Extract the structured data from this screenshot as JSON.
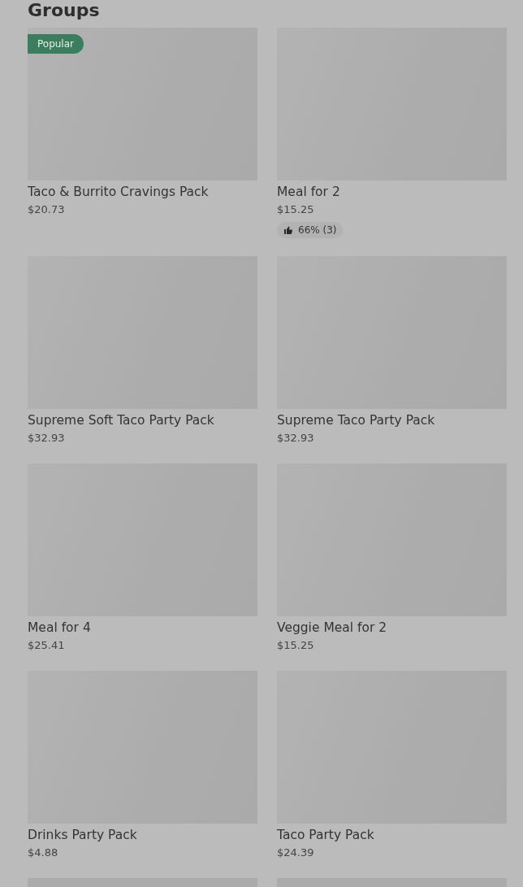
{
  "section": {
    "title": "Groups"
  },
  "items": [
    {
      "name": "Taco & Burrito Cravings Pack",
      "price": "$20.73",
      "badge": "Popular"
    },
    {
      "name": "Meal for 2",
      "price": "$15.25",
      "rating": "66% (3)"
    },
    {
      "name": "Supreme Soft Taco Party Pack",
      "price": "$32.93"
    },
    {
      "name": "Supreme Taco Party Pack",
      "price": "$32.93"
    },
    {
      "name": "Meal for 4",
      "price": "$25.41"
    },
    {
      "name": "Veggie Meal for 2",
      "price": "$15.25"
    },
    {
      "name": "Drinks Party Pack",
      "price": "$4.88"
    },
    {
      "name": "Taco Party Pack",
      "price": "$24.39"
    }
  ]
}
